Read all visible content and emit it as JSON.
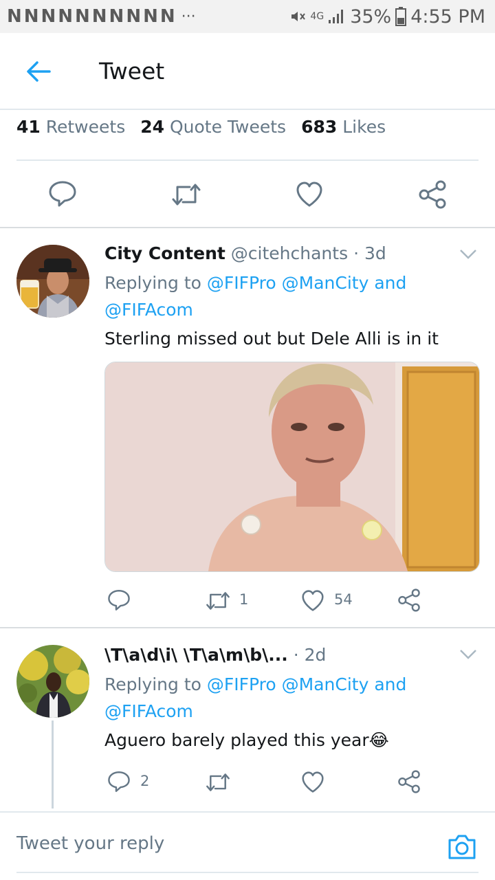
{
  "statusbar": {
    "notifications": "NNNNNNNNNN",
    "overflow": "···",
    "network": "4G",
    "battery": "35%",
    "time": "4:55 PM"
  },
  "appbar": {
    "title": "Tweet"
  },
  "stats": {
    "retweets_count": "41",
    "retweets_label": "Retweets",
    "quotes_count": "24",
    "quotes_label": "Quote Tweets",
    "likes_count": "683",
    "likes_label": "Likes"
  },
  "tweets": [
    {
      "name": "City Content",
      "handle": "@citehchants",
      "time": "· 3d",
      "replying_prefix": "Replying to ",
      "mentions": "@FIFPro @ManCity",
      "and": " and",
      "mention2": "@FIFAcom",
      "text": "Sterling missed out but Dele Alli is in it",
      "retweets": "1",
      "likes": "54"
    },
    {
      "name": "\\T\\a\\d\\i\\ \\T\\a\\m\\b\\...",
      "time": "· 2d",
      "replying_prefix": "Replying to ",
      "mentions": "@FIFPro @ManCity",
      "and": " and",
      "mention2": "@FIFAcom",
      "text": "Aguero barely played this year😂",
      "replies": "2"
    }
  ],
  "composer": {
    "placeholder": "Tweet your reply"
  },
  "colors": {
    "accent": "#1da1f2",
    "secondary_text": "#657786",
    "border": "#e1e8ed"
  },
  "icons": [
    "back-arrow-icon",
    "reply-icon",
    "retweet-icon",
    "like-icon",
    "share-icon",
    "caret-down-icon",
    "camera-icon"
  ]
}
